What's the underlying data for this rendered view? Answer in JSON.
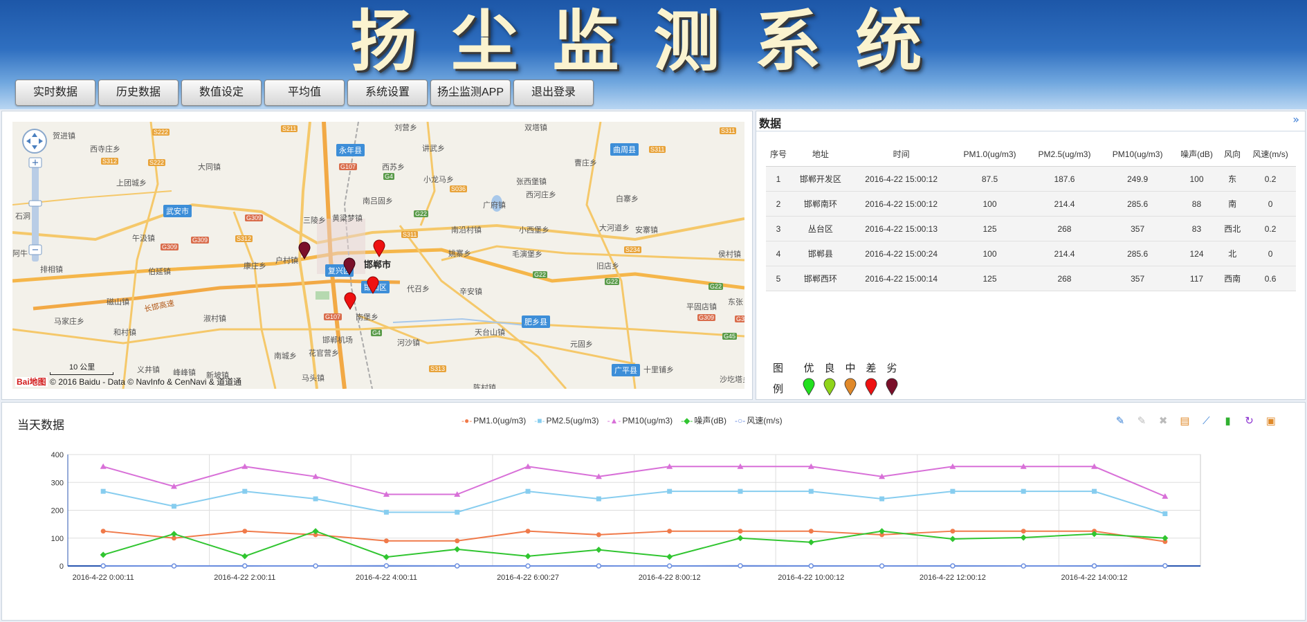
{
  "header": {
    "title": "扬尘监测系统"
  },
  "nav": [
    "实时数据",
    "历史数据",
    "数值设定",
    "平均值",
    "系统设置",
    "扬尘监测APP",
    "退出登录"
  ],
  "map": {
    "copyright": "© 2016 Baidu - Data © NavInfo & CenNavi & 道道通",
    "scale": "10 公里",
    "logo": "Bai地图",
    "cities": [
      {
        "name": "永年县"
      },
      {
        "name": "曲周县"
      },
      {
        "name": "武安市"
      },
      {
        "name": "复兴区"
      },
      {
        "name": "邯山区"
      },
      {
        "name": "肥乡县"
      },
      {
        "name": "广平县"
      }
    ],
    "places": [
      "贺进镇",
      "西寺庄乡",
      "大同镇",
      "上团城乡",
      "午汲镇",
      "伯延镇",
      "排相镇",
      "磁山镇",
      "马家庄乡",
      "和村镇",
      "淑村镇",
      "康庄乡",
      "户村镇",
      "三陵乡",
      "黄粱梦镇",
      "南吕固乡",
      "西苏乡",
      "小龙马乡",
      "讲武乡",
      "张西堡镇",
      "西河庄乡",
      "曹庄乡",
      "白寨乡",
      "双塔镇",
      "刘营乡",
      "南沿村镇",
      "小西堡乡",
      "大河道乡",
      "安寨镇",
      "姚寨乡",
      "毛演堡乡",
      "旧店乡",
      "侯村镇",
      "代召乡",
      "辛安镇",
      "平固店镇",
      "东张",
      "南堡乡",
      "河沙镇",
      "邯郸机场",
      "花官营乡",
      "南城乡",
      "天台山镇",
      "元固乡",
      "十里铺乡",
      "马头镇",
      "峰峰镇",
      "新坡镇",
      "义井镇",
      "沙圪塔乡",
      "陈村镇",
      "石洞",
      "阿牛",
      "邯郸市",
      "广府镇",
      "长邯高速"
    ],
    "roads": [
      "S222",
      "S211",
      "S222",
      "S312",
      "G107",
      "G4",
      "S036",
      "S311",
      "S311",
      "G309",
      "S312",
      "G309",
      "G309",
      "G22",
      "S311",
      "S234",
      "G22",
      "G22",
      "G22",
      "G107",
      "G309",
      "G45",
      "S313",
      "G4",
      "G3"
    ]
  },
  "data_panel": {
    "title": "数据",
    "columns": [
      "序号",
      "地址",
      "时间",
      "PM1.0(ug/m3)",
      "PM2.5(ug/m3)",
      "PM10(ug/m3)",
      "噪声(dB)",
      "风向",
      "风速(m/s)"
    ],
    "rows": [
      [
        "1",
        "邯郸开发区",
        "2016-4-22 15:00:12",
        "87.5",
        "187.6",
        "249.9",
        "100",
        "东",
        "0.2"
      ],
      [
        "2",
        "邯郸南环",
        "2016-4-22 15:00:12",
        "100",
        "214.4",
        "285.6",
        "88",
        "南",
        "0"
      ],
      [
        "3",
        "丛台区",
        "2016-4-22 15:00:13",
        "125",
        "268",
        "357",
        "83",
        "西北",
        "0.2"
      ],
      [
        "4",
        "邯郸县",
        "2016-4-22 15:00:24",
        "100",
        "214.4",
        "285.6",
        "124",
        "北",
        "0"
      ],
      [
        "5",
        "邯郸西环",
        "2016-4-22 15:00:14",
        "125",
        "268",
        "357",
        "117",
        "西南",
        "0.6"
      ]
    ],
    "legend": {
      "label_top": "图",
      "label_bottom": "例",
      "levels": [
        {
          "name": "优",
          "color": "#22e01e"
        },
        {
          "name": "良",
          "color": "#8fd41a"
        },
        {
          "name": "中",
          "color": "#e0892a"
        },
        {
          "name": "差",
          "color": "#ee1111"
        },
        {
          "name": "劣",
          "color": "#7a0f2a"
        }
      ]
    }
  },
  "chart_panel": {
    "title": "当天数据"
  },
  "chart_data": {
    "type": "line",
    "x": [
      "2016-4-22 0:00:11",
      "",
      "2016-4-22 2:00:11",
      "",
      "2016-4-22 4:00:11",
      "",
      "2016-4-22 6:00:27",
      "",
      "2016-4-22 8:00:12",
      "",
      "2016-4-22 10:00:12",
      "",
      "2016-4-22 12:00:12",
      "",
      "2016-4-22 14:00:12",
      ""
    ],
    "xticks": [
      "2016-4-22 0:00:11",
      "2016-4-22 2:00:11",
      "2016-4-22 4:00:11",
      "2016-4-22 6:00:27",
      "2016-4-22 8:00:12",
      "2016-4-22 10:00:12",
      "2016-4-22 12:00:12",
      "2016-4-22 14:00:12"
    ],
    "ylim": [
      0,
      400
    ],
    "yticks": [
      0,
      100,
      200,
      300,
      400
    ],
    "series": [
      {
        "name": "PM1.0(ug/m3)",
        "color": "#f07a4a",
        "marker": "circle",
        "values": [
          125,
          100,
          125,
          112,
          90,
          90,
          125,
          112,
          125,
          125,
          125,
          112,
          125,
          125,
          125,
          87.5
        ]
      },
      {
        "name": "PM2.5(ug/m3)",
        "color": "#87cdef",
        "marker": "square",
        "values": [
          268,
          214.4,
          268,
          241,
          193,
          193,
          268,
          241,
          268,
          268,
          268,
          241,
          268,
          268,
          268,
          187.6
        ]
      },
      {
        "name": "PM10(ug/m3)",
        "color": "#d870d8",
        "marker": "triangle",
        "values": [
          357,
          285.6,
          357,
          321,
          257,
          257,
          357,
          321,
          357,
          357,
          357,
          321,
          357,
          357,
          357,
          249.9
        ]
      },
      {
        "name": "噪声(dB)",
        "color": "#30c530",
        "marker": "diamond",
        "values": [
          40,
          115,
          35,
          125,
          32,
          60,
          35,
          58,
          33,
          100,
          85,
          125,
          97,
          102,
          115,
          100
        ]
      },
      {
        "name": "风速(m/s)",
        "color": "#6c8fe0",
        "marker": "circle-open",
        "values": [
          0.2,
          0,
          0.2,
          0,
          0.6,
          0.2,
          0,
          0.2,
          0,
          0.6,
          0.2,
          0,
          0.2,
          0,
          0.2,
          0.6
        ]
      }
    ],
    "toolbox": [
      "mark-icon",
      "mark-undo-icon",
      "mark-clear-icon",
      "data-view-icon",
      "line-switch-icon",
      "bar-switch-icon",
      "restore-icon",
      "save-image-icon"
    ]
  }
}
